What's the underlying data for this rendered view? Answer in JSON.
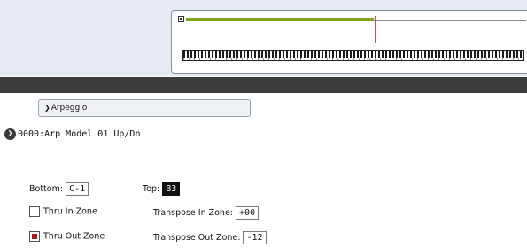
{
  "arpeggio": {
    "tab_label": "Arpeggio",
    "program_label": "0000:Arp Model 01 Up/Dn"
  },
  "zone": {
    "bottom_label": "Bottom:",
    "bottom_value": "C-1",
    "top_label": "Top:",
    "top_value": "B3",
    "thru_in_label": "Thru In Zone",
    "thru_in_checked": false,
    "thru_out_label": "Thru Out Zone",
    "thru_out_checked": true,
    "transpose_in_label": "Transpose In Zone:",
    "transpose_in_value": "+00",
    "transpose_out_label": "Transpose Out Zone:",
    "transpose_out_value": "-12"
  },
  "colors": {
    "range_bar": "#7fa520",
    "split_line": "#d6465c",
    "checkbox_checked": "#b01818"
  }
}
